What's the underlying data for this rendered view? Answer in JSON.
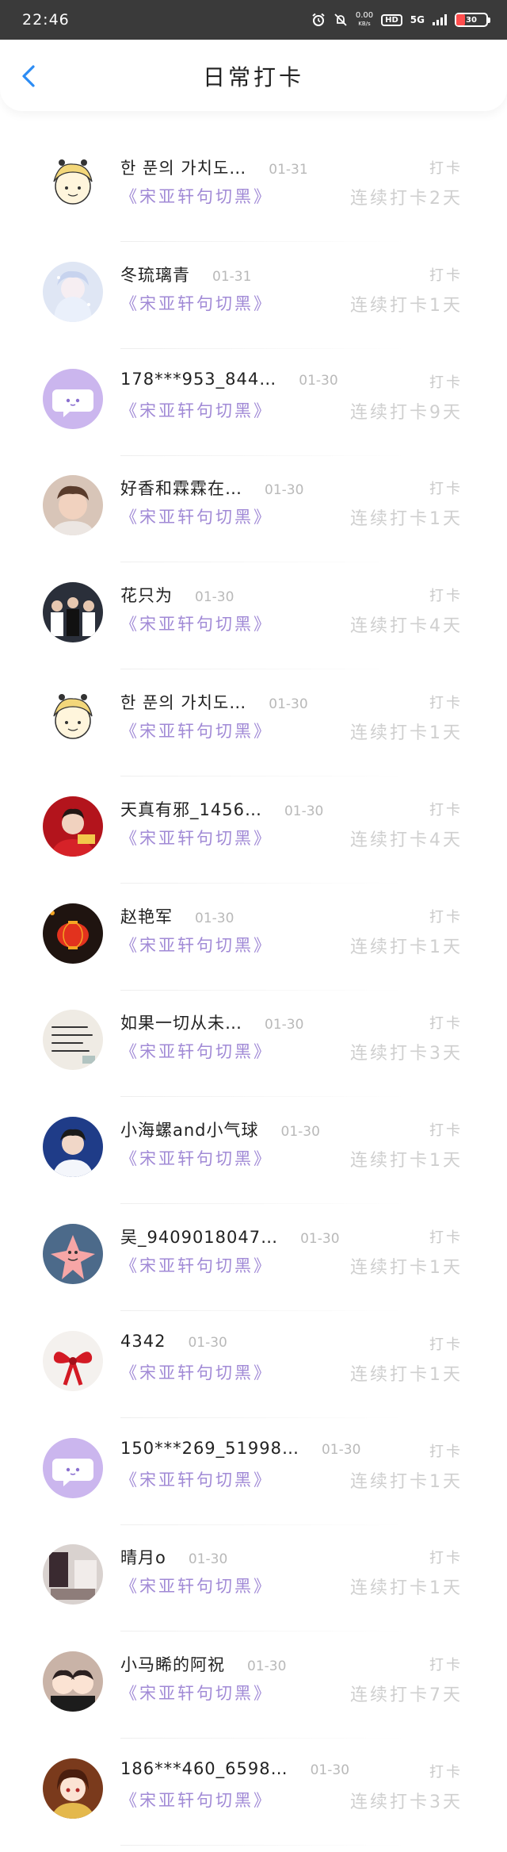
{
  "status_bar": {
    "time": "22:46",
    "net_speed_value": "0.00",
    "net_speed_unit": "KB/s",
    "hd": "HD",
    "network": "5G",
    "battery": "30",
    "battery_level": 0.3
  },
  "header": {
    "title": "日常打卡"
  },
  "items": [
    {
      "name": "한 푼의 가치도…",
      "date": "01-31",
      "book": "《宋亚轩句切黑》",
      "label": "打卡",
      "streak": "连续打卡2天",
      "avatar": "cartoon-girl"
    },
    {
      "name": "冬琉璃青",
      "date": "01-31",
      "book": "《宋亚轩句切黑》",
      "label": "打卡",
      "streak": "连续打卡1天",
      "avatar": "snow-girl"
    },
    {
      "name": "178***953_844…",
      "date": "01-30",
      "book": "《宋亚轩句切黑》",
      "label": "打卡",
      "streak": "连续打卡9天",
      "avatar": "default-chat"
    },
    {
      "name": "好香和霖霖在…",
      "date": "01-30",
      "book": "《宋亚轩句切黑》",
      "label": "打卡",
      "streak": "连续打卡1天",
      "avatar": "photo-boy"
    },
    {
      "name": "花只为",
      "date": "01-30",
      "book": "《宋亚轩句切黑》",
      "label": "打卡",
      "streak": "连续打卡4天",
      "avatar": "group-photo"
    },
    {
      "name": "한 푼의 가치도…",
      "date": "01-30",
      "book": "《宋亚轩句切黑》",
      "label": "打卡",
      "streak": "连续打卡1天",
      "avatar": "cartoon-girl"
    },
    {
      "name": "天真有邪_1456…",
      "date": "01-30",
      "book": "《宋亚轩句切黑》",
      "label": "打卡",
      "streak": "连续打卡4天",
      "avatar": "red-photo"
    },
    {
      "name": "赵艳军",
      "date": "01-30",
      "book": "《宋亚轩句切黑》",
      "label": "打卡",
      "streak": "连续打卡1天",
      "avatar": "lantern-night"
    },
    {
      "name": "如果一切从未…",
      "date": "01-30",
      "book": "《宋亚轩句切黑》",
      "label": "打卡",
      "streak": "连续打卡3天",
      "avatar": "handwriting-note"
    },
    {
      "name": "小海螺and小气球",
      "date": "01-30",
      "book": "《宋亚轩句切黑》",
      "label": "打卡",
      "streak": "连续打卡1天",
      "avatar": "blue-photo"
    },
    {
      "name": "吴_9409018047…",
      "date": "01-30",
      "book": "《宋亚轩句切黑》",
      "label": "打卡",
      "streak": "连续打卡1天",
      "avatar": "patrick-star"
    },
    {
      "name": "4342",
      "date": "01-30",
      "book": "《宋亚轩句切黑》",
      "label": "打卡",
      "streak": "连续打卡1天",
      "avatar": "red-ribbon"
    },
    {
      "name": "150***269_51998…",
      "date": "01-30",
      "book": "《宋亚轩句切黑》",
      "label": "打卡",
      "streak": "连续打卡1天",
      "avatar": "default-chat"
    },
    {
      "name": "晴月o",
      "date": "01-30",
      "book": "《宋亚轩句切黑》",
      "label": "打卡",
      "streak": "连续打卡1天",
      "avatar": "room-photo"
    },
    {
      "name": "小马睎的阿祝",
      "date": "01-30",
      "book": "《宋亚轩句切黑》",
      "label": "打卡",
      "streak": "连续打卡7天",
      "avatar": "cartoon-pair"
    },
    {
      "name": "186***460_6598…",
      "date": "01-30",
      "book": "《宋亚轩句切黑》",
      "label": "打卡",
      "streak": "连续打卡3天",
      "avatar": "anime-girl"
    }
  ],
  "colors": {
    "accent_blue": "#2c8cf4",
    "book_purple": "#a18ad6",
    "muted": "#c9c9c9",
    "status_bar_bg": "#3a3a3a"
  }
}
